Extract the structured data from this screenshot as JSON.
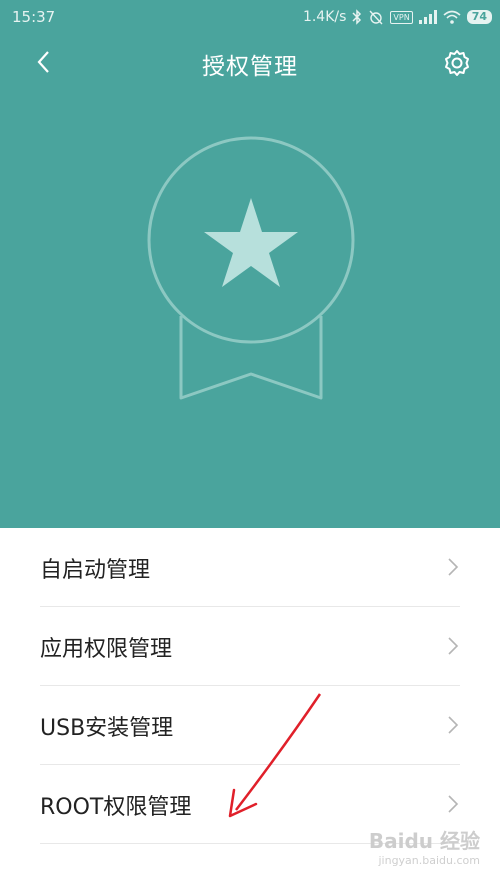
{
  "status_bar": {
    "time": "15:37",
    "speed": "1.4K/s",
    "vpn": "VPN",
    "battery": "74",
    "icons": [
      "bluetooth-icon",
      "alarm-off-icon",
      "vpn-icon",
      "signal-icon",
      "wifi-icon",
      "battery-icon"
    ]
  },
  "navbar": {
    "title": "授权管理",
    "back_icon": "chevron-left-icon",
    "settings_icon": "gear-icon"
  },
  "hero": {
    "icon": "star-medal-icon",
    "background_color": "#4aa49d"
  },
  "menu": {
    "items": [
      {
        "label": "自启动管理"
      },
      {
        "label": "应用权限管理"
      },
      {
        "label": "USB安装管理"
      },
      {
        "label": "ROOT权限管理"
      }
    ]
  },
  "annotation": {
    "type": "red-arrow",
    "target": "ROOT权限管理",
    "color": "#e0202a"
  },
  "watermark": {
    "text": "Baidu 经验",
    "url": "jingyan.baidu.com"
  }
}
